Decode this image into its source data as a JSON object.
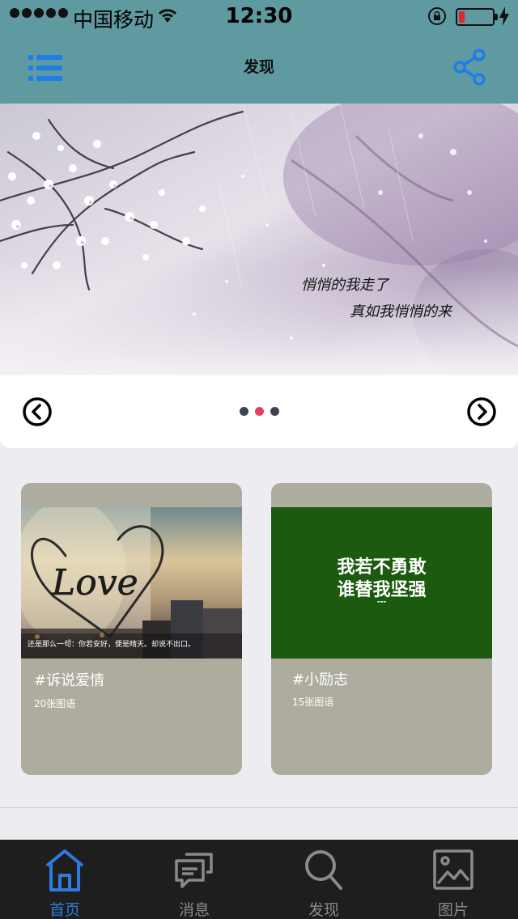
{
  "status_bar": {
    "carrier": "中国移动",
    "time": "12:30",
    "battery_level": 0.18,
    "battery_color": "#e0262b"
  },
  "header": {
    "title": "发现",
    "menu_icon": "list-icon",
    "share_icon": "share-icon",
    "accent": "#1e7ee8",
    "background": "#5f9aa1"
  },
  "banner": {
    "caption_line1": "悄悄的我走了",
    "caption_line2": "真如我悄悄的来"
  },
  "carousel": {
    "page_count": 3,
    "active_index": 1,
    "active_dot_color": "#e2435c"
  },
  "cards": [
    {
      "title": "#诉说爱情",
      "subtitle": "20张图语",
      "image_caption": "还是那么一句：你若安好，便是晴天。却说不出口。"
    },
    {
      "title": "#小励志",
      "subtitle": "15张图语",
      "poster_line1": "我若不勇敢",
      "poster_line2": "谁替我坚强",
      "poster_background": "#1c5a0f"
    }
  ],
  "tabbar": {
    "active_color": "#2d7be0",
    "tabs": [
      {
        "label": "首页",
        "icon": "home-icon",
        "active": true
      },
      {
        "label": "消息",
        "icon": "message-icon",
        "active": false
      },
      {
        "label": "发现",
        "icon": "search-icon",
        "active": false
      },
      {
        "label": "图片",
        "icon": "image-icon",
        "active": false
      }
    ]
  }
}
